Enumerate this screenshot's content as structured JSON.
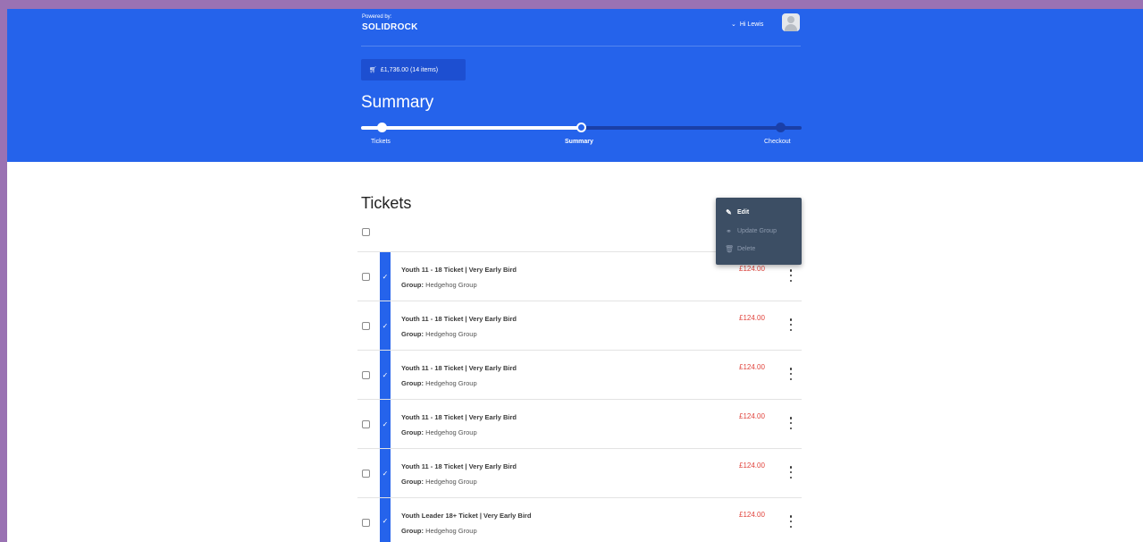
{
  "header": {
    "powered_by": "Powered by:",
    "brand": "SOLIDROCK",
    "greeting": "Hi Lewis",
    "cart_label": "£1,736.00 (14 items)",
    "page_title": "Summary"
  },
  "progress": {
    "steps": [
      {
        "label": "Tickets",
        "state": "complete"
      },
      {
        "label": "Summary",
        "state": "current"
      },
      {
        "label": "Checkout",
        "state": "upcoming"
      }
    ]
  },
  "section": {
    "title": "Tickets"
  },
  "context_menu": {
    "items": [
      {
        "label": "Edit",
        "icon": "pencil-icon",
        "enabled": true
      },
      {
        "label": "Update Group",
        "icon": "group-icon",
        "enabled": false
      },
      {
        "label": "Delete",
        "icon": "trash-icon",
        "enabled": false
      }
    ]
  },
  "tickets": [
    {
      "name": "Youth 11 - 18 Ticket | Very Early Bird",
      "group_label": "Group:",
      "group": "Hedgehog Group",
      "price": "£124.00"
    },
    {
      "name": "Youth 11 - 18 Ticket | Very Early Bird",
      "group_label": "Group:",
      "group": "Hedgehog Group",
      "price": "£124.00"
    },
    {
      "name": "Youth 11 - 18 Ticket | Very Early Bird",
      "group_label": "Group:",
      "group": "Hedgehog Group",
      "price": "£124.00"
    },
    {
      "name": "Youth 11 - 18 Ticket | Very Early Bird",
      "group_label": "Group:",
      "group": "Hedgehog Group",
      "price": "£124.00"
    },
    {
      "name": "Youth 11 - 18 Ticket | Very Early Bird",
      "group_label": "Group:",
      "group": "Hedgehog Group",
      "price": "£124.00"
    },
    {
      "name": "Youth Leader 18+ Ticket | Very Early Bird",
      "group_label": "Group:",
      "group": "Hedgehog Group",
      "price": "£124.00"
    }
  ],
  "colors": {
    "brand_blue": "#2563eb",
    "price_red": "#e0433c",
    "menu_bg": "#3c4e64"
  }
}
